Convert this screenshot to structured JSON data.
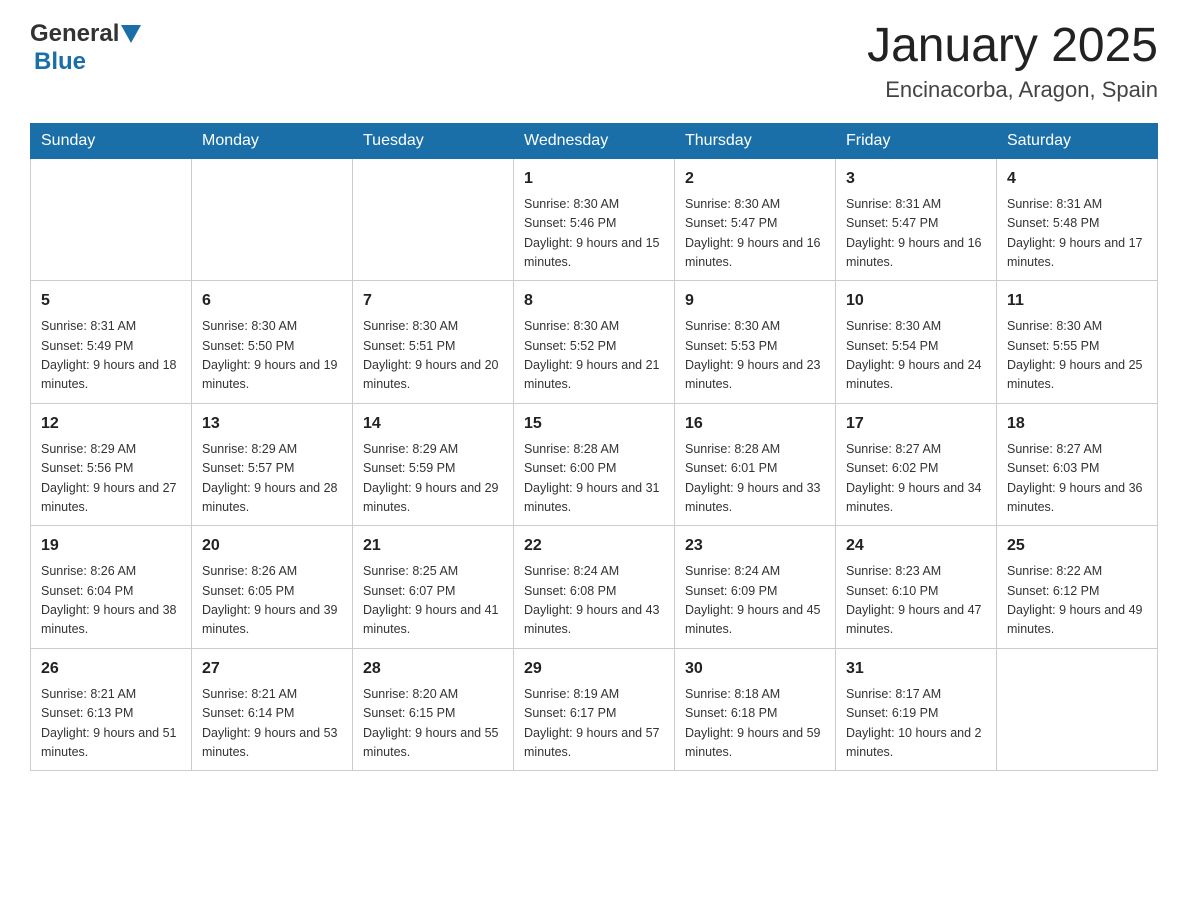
{
  "header": {
    "logo_general": "General",
    "logo_blue": "Blue",
    "title": "January 2025",
    "subtitle": "Encinacorba, Aragon, Spain"
  },
  "days_of_week": [
    "Sunday",
    "Monday",
    "Tuesday",
    "Wednesday",
    "Thursday",
    "Friday",
    "Saturday"
  ],
  "weeks": [
    [
      {
        "day": "",
        "sunrise": "",
        "sunset": "",
        "daylight": ""
      },
      {
        "day": "",
        "sunrise": "",
        "sunset": "",
        "daylight": ""
      },
      {
        "day": "",
        "sunrise": "",
        "sunset": "",
        "daylight": ""
      },
      {
        "day": "1",
        "sunrise": "Sunrise: 8:30 AM",
        "sunset": "Sunset: 5:46 PM",
        "daylight": "Daylight: 9 hours and 15 minutes."
      },
      {
        "day": "2",
        "sunrise": "Sunrise: 8:30 AM",
        "sunset": "Sunset: 5:47 PM",
        "daylight": "Daylight: 9 hours and 16 minutes."
      },
      {
        "day": "3",
        "sunrise": "Sunrise: 8:31 AM",
        "sunset": "Sunset: 5:47 PM",
        "daylight": "Daylight: 9 hours and 16 minutes."
      },
      {
        "day": "4",
        "sunrise": "Sunrise: 8:31 AM",
        "sunset": "Sunset: 5:48 PM",
        "daylight": "Daylight: 9 hours and 17 minutes."
      }
    ],
    [
      {
        "day": "5",
        "sunrise": "Sunrise: 8:31 AM",
        "sunset": "Sunset: 5:49 PM",
        "daylight": "Daylight: 9 hours and 18 minutes."
      },
      {
        "day": "6",
        "sunrise": "Sunrise: 8:30 AM",
        "sunset": "Sunset: 5:50 PM",
        "daylight": "Daylight: 9 hours and 19 minutes."
      },
      {
        "day": "7",
        "sunrise": "Sunrise: 8:30 AM",
        "sunset": "Sunset: 5:51 PM",
        "daylight": "Daylight: 9 hours and 20 minutes."
      },
      {
        "day": "8",
        "sunrise": "Sunrise: 8:30 AM",
        "sunset": "Sunset: 5:52 PM",
        "daylight": "Daylight: 9 hours and 21 minutes."
      },
      {
        "day": "9",
        "sunrise": "Sunrise: 8:30 AM",
        "sunset": "Sunset: 5:53 PM",
        "daylight": "Daylight: 9 hours and 23 minutes."
      },
      {
        "day": "10",
        "sunrise": "Sunrise: 8:30 AM",
        "sunset": "Sunset: 5:54 PM",
        "daylight": "Daylight: 9 hours and 24 minutes."
      },
      {
        "day": "11",
        "sunrise": "Sunrise: 8:30 AM",
        "sunset": "Sunset: 5:55 PM",
        "daylight": "Daylight: 9 hours and 25 minutes."
      }
    ],
    [
      {
        "day": "12",
        "sunrise": "Sunrise: 8:29 AM",
        "sunset": "Sunset: 5:56 PM",
        "daylight": "Daylight: 9 hours and 27 minutes."
      },
      {
        "day": "13",
        "sunrise": "Sunrise: 8:29 AM",
        "sunset": "Sunset: 5:57 PM",
        "daylight": "Daylight: 9 hours and 28 minutes."
      },
      {
        "day": "14",
        "sunrise": "Sunrise: 8:29 AM",
        "sunset": "Sunset: 5:59 PM",
        "daylight": "Daylight: 9 hours and 29 minutes."
      },
      {
        "day": "15",
        "sunrise": "Sunrise: 8:28 AM",
        "sunset": "Sunset: 6:00 PM",
        "daylight": "Daylight: 9 hours and 31 minutes."
      },
      {
        "day": "16",
        "sunrise": "Sunrise: 8:28 AM",
        "sunset": "Sunset: 6:01 PM",
        "daylight": "Daylight: 9 hours and 33 minutes."
      },
      {
        "day": "17",
        "sunrise": "Sunrise: 8:27 AM",
        "sunset": "Sunset: 6:02 PM",
        "daylight": "Daylight: 9 hours and 34 minutes."
      },
      {
        "day": "18",
        "sunrise": "Sunrise: 8:27 AM",
        "sunset": "Sunset: 6:03 PM",
        "daylight": "Daylight: 9 hours and 36 minutes."
      }
    ],
    [
      {
        "day": "19",
        "sunrise": "Sunrise: 8:26 AM",
        "sunset": "Sunset: 6:04 PM",
        "daylight": "Daylight: 9 hours and 38 minutes."
      },
      {
        "day": "20",
        "sunrise": "Sunrise: 8:26 AM",
        "sunset": "Sunset: 6:05 PM",
        "daylight": "Daylight: 9 hours and 39 minutes."
      },
      {
        "day": "21",
        "sunrise": "Sunrise: 8:25 AM",
        "sunset": "Sunset: 6:07 PM",
        "daylight": "Daylight: 9 hours and 41 minutes."
      },
      {
        "day": "22",
        "sunrise": "Sunrise: 8:24 AM",
        "sunset": "Sunset: 6:08 PM",
        "daylight": "Daylight: 9 hours and 43 minutes."
      },
      {
        "day": "23",
        "sunrise": "Sunrise: 8:24 AM",
        "sunset": "Sunset: 6:09 PM",
        "daylight": "Daylight: 9 hours and 45 minutes."
      },
      {
        "day": "24",
        "sunrise": "Sunrise: 8:23 AM",
        "sunset": "Sunset: 6:10 PM",
        "daylight": "Daylight: 9 hours and 47 minutes."
      },
      {
        "day": "25",
        "sunrise": "Sunrise: 8:22 AM",
        "sunset": "Sunset: 6:12 PM",
        "daylight": "Daylight: 9 hours and 49 minutes."
      }
    ],
    [
      {
        "day": "26",
        "sunrise": "Sunrise: 8:21 AM",
        "sunset": "Sunset: 6:13 PM",
        "daylight": "Daylight: 9 hours and 51 minutes."
      },
      {
        "day": "27",
        "sunrise": "Sunrise: 8:21 AM",
        "sunset": "Sunset: 6:14 PM",
        "daylight": "Daylight: 9 hours and 53 minutes."
      },
      {
        "day": "28",
        "sunrise": "Sunrise: 8:20 AM",
        "sunset": "Sunset: 6:15 PM",
        "daylight": "Daylight: 9 hours and 55 minutes."
      },
      {
        "day": "29",
        "sunrise": "Sunrise: 8:19 AM",
        "sunset": "Sunset: 6:17 PM",
        "daylight": "Daylight: 9 hours and 57 minutes."
      },
      {
        "day": "30",
        "sunrise": "Sunrise: 8:18 AM",
        "sunset": "Sunset: 6:18 PM",
        "daylight": "Daylight: 9 hours and 59 minutes."
      },
      {
        "day": "31",
        "sunrise": "Sunrise: 8:17 AM",
        "sunset": "Sunset: 6:19 PM",
        "daylight": "Daylight: 10 hours and 2 minutes."
      },
      {
        "day": "",
        "sunrise": "",
        "sunset": "",
        "daylight": ""
      }
    ]
  ]
}
